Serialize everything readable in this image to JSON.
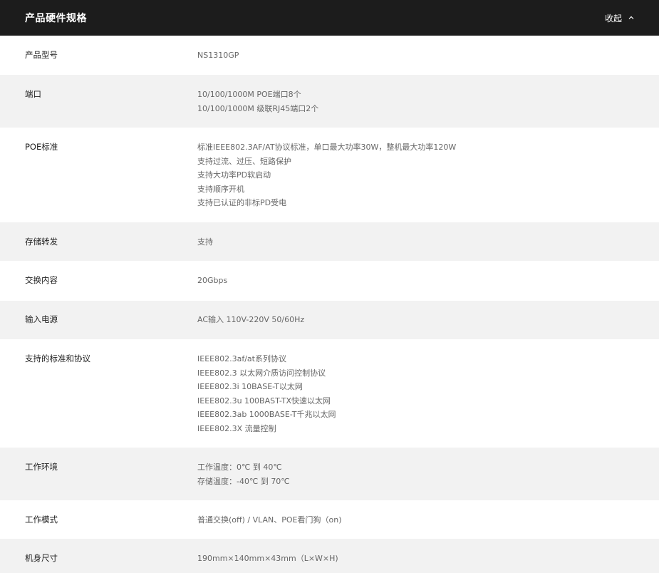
{
  "header": {
    "title": "产品硬件规格",
    "collapse_label": "收起",
    "collapse_icon": "chevron-up-icon"
  },
  "specs": [
    {
      "label": "产品型号",
      "values": [
        "NS1310GP"
      ]
    },
    {
      "label": "端口",
      "values": [
        "10/100/1000M POE端口8个",
        "10/100/1000M 级联RJ45端口2个"
      ]
    },
    {
      "label": "POE标准",
      "values": [
        "标准IEEE802.3AF/AT协议标准，单口最大功率30W，整机最大功率120W",
        "支持过流、过压、短路保护",
        "支持大功率PD软启动",
        "支持顺序开机",
        "支持已认证的非标PD受电"
      ]
    },
    {
      "label": "存储转发",
      "values": [
        "支持"
      ]
    },
    {
      "label": "交换内容",
      "values": [
        "20Gbps"
      ]
    },
    {
      "label": "输入电源",
      "values": [
        "AC输入 110V-220V 50/60Hz"
      ]
    },
    {
      "label": "支持的标准和协议",
      "values": [
        "IEEE802.3af/at系列协议",
        "IEEE802.3 以太网介质访问控制协议",
        "IEEE802.3i 10BASE-T以太网",
        "IEEE802.3u 100BAST-TX快速以太网",
        "IEEE802.3ab 1000BASE-T千兆以太网",
        "IEEE802.3X 流量控制"
      ]
    },
    {
      "label": "工作环境",
      "values": [
        "工作温度：0℃ 到 40℃",
        "存储温度：-40℃ 到 70℃"
      ]
    },
    {
      "label": "工作模式",
      "values": [
        "普通交换(off) / VLAN、POE看门狗（on)"
      ]
    },
    {
      "label": "机身尺寸",
      "values": [
        "190mm×140mm×43mm（L×W×H)"
      ]
    }
  ]
}
